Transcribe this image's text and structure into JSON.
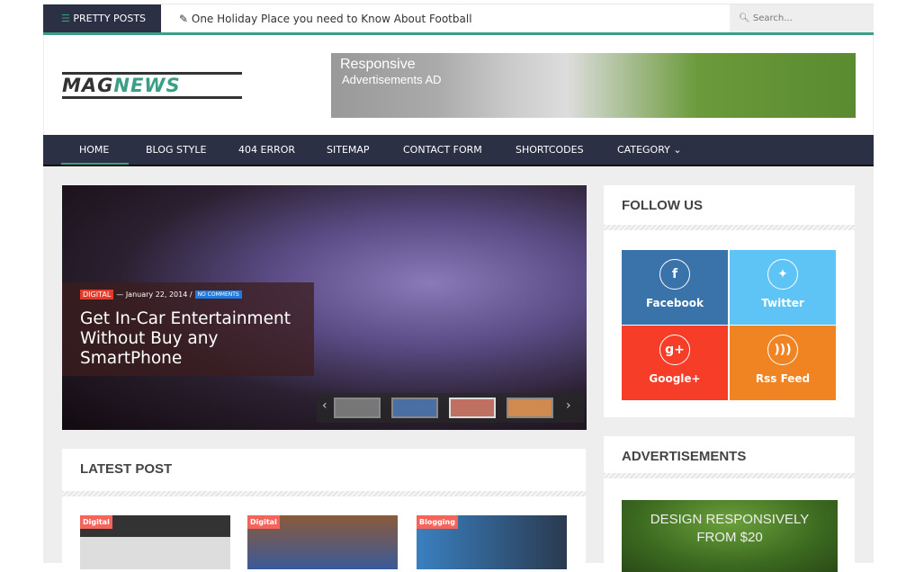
{
  "topbar": {
    "menu_label": "PRETTY POSTS",
    "ticker": "One Holiday Place you need to Know About Football",
    "search_placeholder": "Search..."
  },
  "header": {
    "logo_left": "MAG",
    "logo_right": "NEWS",
    "ad_title": "Responsive",
    "ad_subtitle": "Advertisements AD"
  },
  "nav": {
    "items": [
      "HOME",
      "BLOG STYLE",
      "404 ERROR",
      "SITEMAP",
      "CONTACT FORM",
      "SHORTCODES",
      "CATEGORY"
    ],
    "active": "HOME"
  },
  "slider": {
    "category": "DIGITAL",
    "date": "— January 22, 2014 /",
    "comments": "NO COMMENTS",
    "title": "Get In-Car Entertainment Without Buy any SmartPhone"
  },
  "follow": {
    "title": "FOLLOW US",
    "items": [
      {
        "label": "Facebook",
        "icon": "f",
        "color": "#3a72aa"
      },
      {
        "label": "Twitter",
        "icon": "🐦",
        "color": "#5ec4f5"
      },
      {
        "label": "Google+",
        "icon": "g+",
        "color": "#f53d27"
      },
      {
        "label": "Rss Feed",
        "icon": "rss",
        "color": "#f18422"
      }
    ]
  },
  "latest": {
    "title": "LATEST POST",
    "posts": [
      {
        "category": "Digital"
      },
      {
        "category": "Digital"
      },
      {
        "category": "Blogging"
      }
    ]
  },
  "ads": {
    "title": "ADVERTISEMENTS",
    "line1": "DESIGN RESPONSIVELY",
    "line2": "FROM $20"
  },
  "colors": {
    "accent": "#3b9e86",
    "nav": "#2b3044"
  }
}
